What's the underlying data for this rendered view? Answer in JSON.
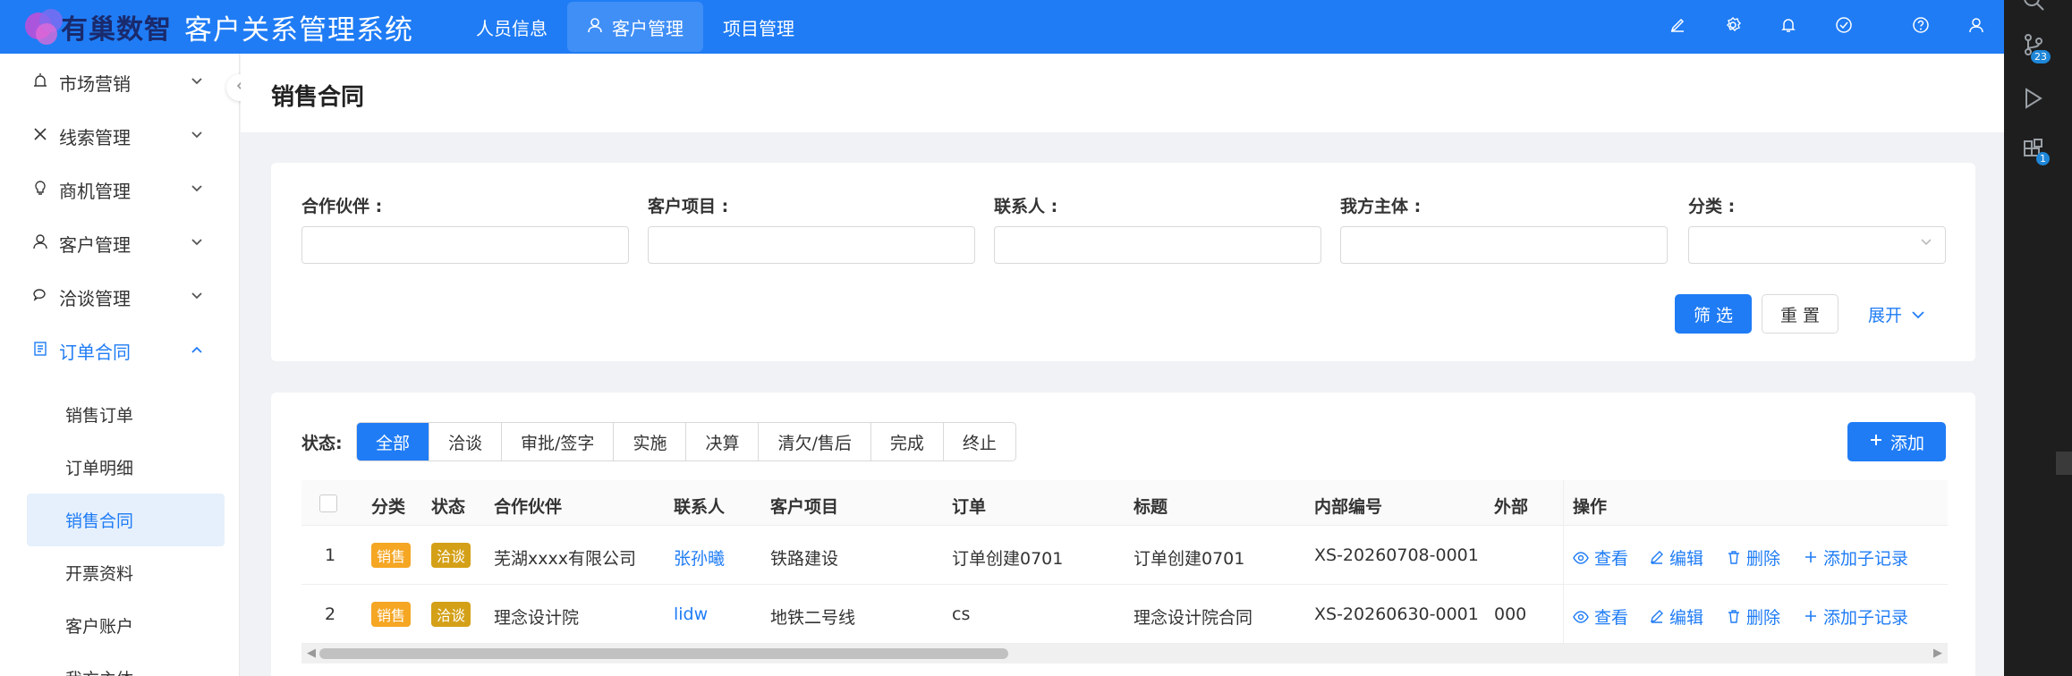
{
  "header": {
    "logo_text": "有巢数智",
    "system_title": "客户关系管理系统",
    "nav": [
      {
        "label": "人员信息",
        "active": false
      },
      {
        "label": "客户管理",
        "active": true
      },
      {
        "label": "项目管理",
        "active": false
      }
    ],
    "tool_icons": [
      "brush-icon",
      "gear-icon",
      "bell-icon",
      "check-circle-icon",
      "help-icon",
      "user-icon"
    ]
  },
  "right_strip": {
    "badges": [
      "23",
      "1"
    ]
  },
  "sidebar": {
    "items": [
      {
        "label": "市场营销",
        "icon": "alarm-icon",
        "open": false
      },
      {
        "label": "线索管理",
        "icon": "x-icon",
        "open": false
      },
      {
        "label": "商机管理",
        "icon": "bulb-icon",
        "open": false
      },
      {
        "label": "客户管理",
        "icon": "user-icon",
        "open": false
      },
      {
        "label": "洽谈管理",
        "icon": "chat-icon",
        "open": false
      },
      {
        "label": "订单合同",
        "icon": "doc-icon",
        "open": true
      }
    ],
    "sub_items": [
      {
        "label": "销售订单",
        "active": false
      },
      {
        "label": "订单明细",
        "active": false
      },
      {
        "label": "销售合同",
        "active": true
      },
      {
        "label": "开票资料",
        "active": false
      },
      {
        "label": "客户账户",
        "active": false
      },
      {
        "label": "我方主体",
        "active": false
      }
    ]
  },
  "page": {
    "title": "销售合同"
  },
  "filter": {
    "fields": [
      {
        "label": "合作伙伴 :",
        "value": "",
        "type": "input"
      },
      {
        "label": "客户项目 :",
        "value": "",
        "type": "input"
      },
      {
        "label": "联系人 :",
        "value": "",
        "type": "input"
      },
      {
        "label": "我方主体 :",
        "value": "",
        "type": "input"
      },
      {
        "label": "分类 :",
        "value": "",
        "type": "select"
      }
    ],
    "filter_button": "筛 选",
    "reset_button": "重 置",
    "expand_link": "展开"
  },
  "table": {
    "status_label": "状态:",
    "status_tabs": [
      {
        "label": "全部",
        "active": true
      },
      {
        "label": "洽谈",
        "active": false
      },
      {
        "label": "审批/签字",
        "active": false
      },
      {
        "label": "实施",
        "active": false
      },
      {
        "label": "决算",
        "active": false
      },
      {
        "label": "清欠/售后",
        "active": false
      },
      {
        "label": "完成",
        "active": false
      },
      {
        "label": "终止",
        "active": false
      }
    ],
    "add_button": "添加",
    "columns": [
      "分类",
      "状态",
      "合作伙伴",
      "联系人",
      "客户项目",
      "订单",
      "标题",
      "内部编号",
      "外部",
      "操作"
    ],
    "rows": [
      {
        "index": "1",
        "category": "销售",
        "status": "洽谈",
        "partner": "芜湖xxxx有限公司",
        "contact": "张孙曦",
        "project": "铁路建设",
        "order": "订单创建0701",
        "title": "订单创建0701",
        "internal_no": "XS-20260708-0001",
        "external": ""
      },
      {
        "index": "2",
        "category": "销售",
        "status": "洽谈",
        "partner": "理念设计院",
        "contact": "lidw",
        "project": "地铁二号线",
        "order": "cs",
        "title": "理念设计院合同",
        "internal_no": "XS-20260630-0001",
        "external": "000"
      }
    ],
    "actions": [
      "查看",
      "编辑",
      "删除",
      "添加子记录"
    ]
  },
  "colors": {
    "primary": "#1f7cf5",
    "tag_orange": "#f5a623",
    "tag_gold": "#d4a017"
  }
}
